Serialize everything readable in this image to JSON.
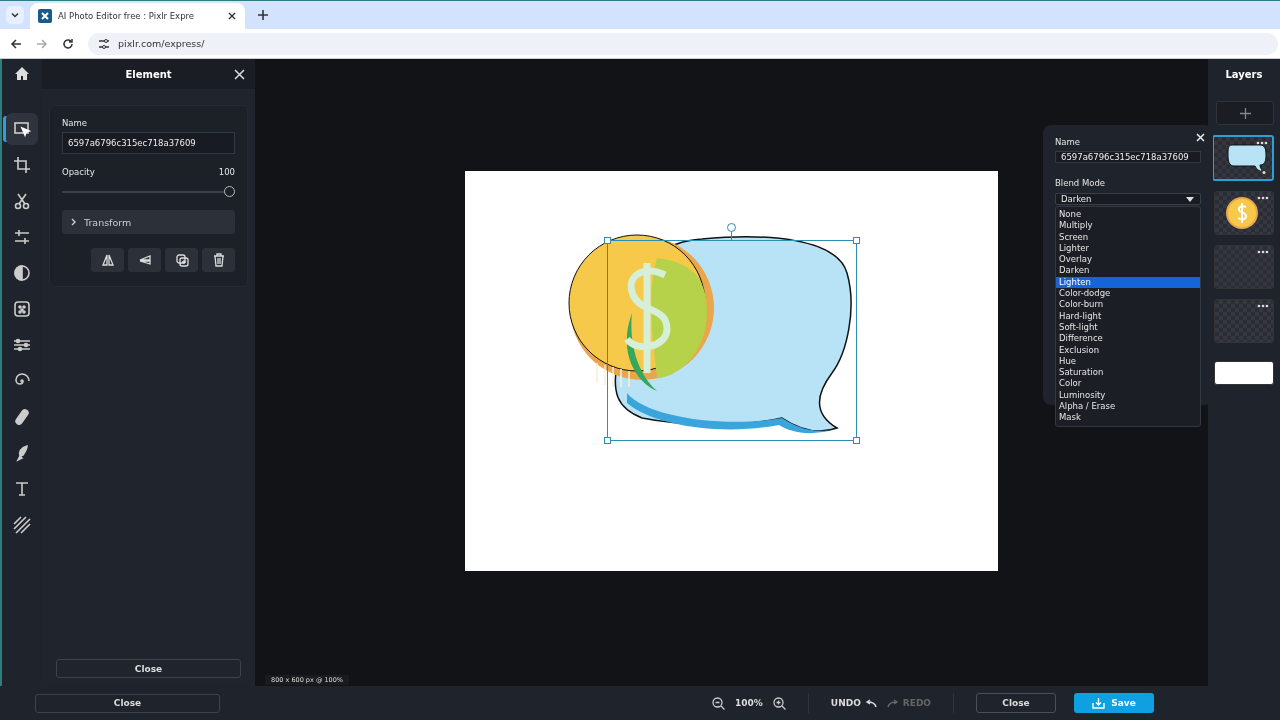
{
  "browser": {
    "tab_title": "AI Photo Editor free : Pixlr Expre",
    "url": "pixlr.com/express/"
  },
  "tool_rail": {
    "tools": [
      {
        "kind": "select",
        "selected": true
      },
      {
        "kind": "crop",
        "selected": false
      },
      {
        "kind": "cut",
        "selected": false
      },
      {
        "kind": "adjust",
        "selected": false
      },
      {
        "kind": "contrast",
        "selected": false
      },
      {
        "kind": "filter",
        "selected": false
      },
      {
        "kind": "sliders",
        "selected": false
      },
      {
        "kind": "liquify",
        "selected": false
      },
      {
        "kind": "heal",
        "selected": false
      },
      {
        "kind": "brush",
        "selected": false
      },
      {
        "kind": "text",
        "selected": false
      },
      {
        "kind": "pattern",
        "selected": false
      }
    ]
  },
  "element_panel": {
    "title": "Element",
    "name_label": "Name",
    "name_value": "6597a6796c315ec718a37609",
    "opacity_label": "Opacity",
    "opacity_value": "100",
    "opacity": {
      "level": 1
    },
    "transform_label": "Transform",
    "actions": [
      {
        "kind": "flip-h"
      },
      {
        "kind": "flip-v"
      },
      {
        "kind": "duplicate"
      },
      {
        "kind": "delete"
      }
    ],
    "close_button": "Close"
  },
  "canvas": {
    "size_info": "800 x 600 px @ 100%"
  },
  "blend_popup": {
    "name_label": "Name",
    "name_value": "6597a6796c315ec718a37609",
    "blend_label": "Blend Mode",
    "blend_value": "Darken",
    "options": [
      {
        "label": "None",
        "selected": false
      },
      {
        "label": "Multiply",
        "selected": false
      },
      {
        "label": "Screen",
        "selected": false
      },
      {
        "label": "Lighter",
        "selected": false
      },
      {
        "label": "Overlay",
        "selected": false
      },
      {
        "label": "Darken",
        "selected": false
      },
      {
        "label": "Lighten",
        "selected": true
      },
      {
        "label": "Color-dodge",
        "selected": false
      },
      {
        "label": "Color-burn",
        "selected": false
      },
      {
        "label": "Hard-light",
        "selected": false
      },
      {
        "label": "Soft-light",
        "selected": false
      },
      {
        "label": "Difference",
        "selected": false
      },
      {
        "label": "Exclusion",
        "selected": false
      },
      {
        "label": "Hue",
        "selected": false
      },
      {
        "label": "Saturation",
        "selected": false
      },
      {
        "label": "Color",
        "selected": false
      },
      {
        "label": "Luminosity",
        "selected": false
      },
      {
        "label": "Alpha / Erase",
        "selected": false
      },
      {
        "label": "Mask",
        "selected": false
      }
    ]
  },
  "layers": {
    "title": "Layers",
    "items": [
      {
        "kind": "bubble",
        "selected": true
      },
      {
        "kind": "coin",
        "selected": false
      },
      {
        "kind": "empty",
        "selected": false
      },
      {
        "kind": "empty",
        "selected": false
      },
      {
        "kind": "background",
        "selected": false
      }
    ]
  },
  "bottom_bar": {
    "panel_close": "Close",
    "zoom": "100%",
    "undo": {
      "label": "UNDO",
      "disabled": false
    },
    "redo": {
      "label": "REDO",
      "disabled": true
    },
    "close": "Close",
    "save": "Save"
  }
}
